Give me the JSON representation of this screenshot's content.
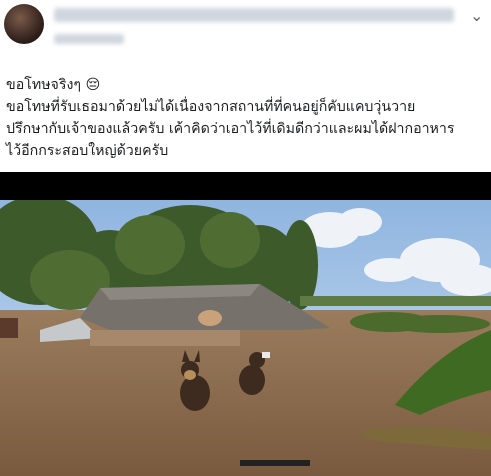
{
  "post": {
    "author_name": "",
    "timestamp": "",
    "text_lines": [
      "ขอโทษจริงๆ",
      "ขอโทษที่รับเธอมาด้วยไม่ได้เนื่องจากสถานที่ที่คนอยู่ก็คับแคบวุ่นวาย",
      "ปรึกษากับเจ้าของแล้วครับ เค้าคิดว่าเอาไว้ที่เดิมดีกว่าและผมได้ฝากอาหาร",
      "ไว้อีกกระสอบใหญ่ด้วยครับ"
    ],
    "emoji": "😔"
  },
  "icons": {
    "more": "more-options-icon",
    "avatar": "avatar",
    "emoji": "pensive-face-emoji"
  },
  "colors": {
    "text": "#1c1e21",
    "water": "#8a6b4c",
    "sky": "#a9c6e6",
    "roof": "#6f6a66"
  }
}
